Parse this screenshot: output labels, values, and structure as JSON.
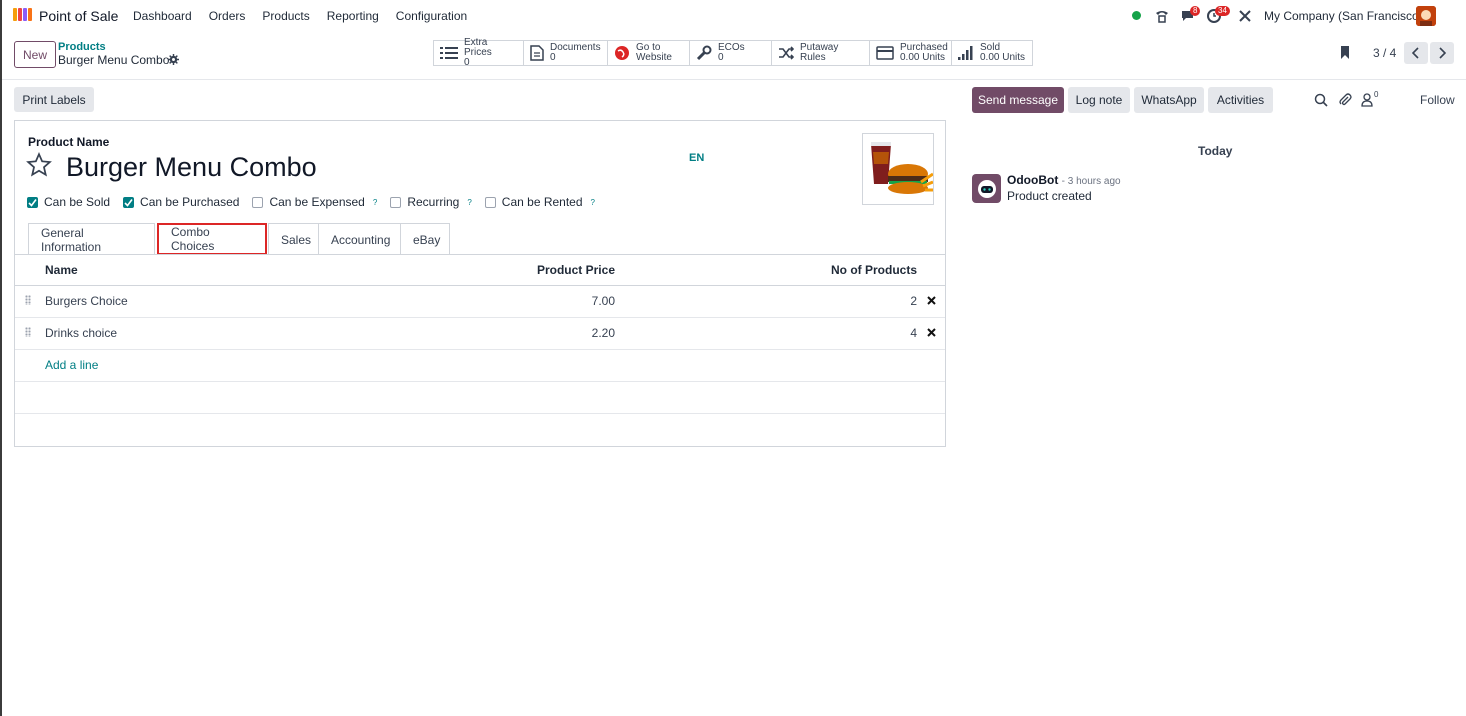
{
  "app": {
    "name": "Point of Sale",
    "menu": [
      "Dashboard",
      "Orders",
      "Products",
      "Reporting",
      "Configuration"
    ]
  },
  "systray": {
    "messages_count": "8",
    "activities_count": "34",
    "company": "My Company (San Francisco)"
  },
  "control": {
    "new_label": "New",
    "breadcrumb_parent": "Products",
    "breadcrumb_current": "Burger Menu Combo",
    "stats": [
      {
        "icon": "list-icon",
        "label": "Extra Prices",
        "value": "0"
      },
      {
        "icon": "document-icon",
        "label": "Documents",
        "value": "0"
      },
      {
        "icon": "globe-icon",
        "label": "Go to",
        "value": "Website"
      },
      {
        "icon": "wrench-icon",
        "label": "ECOs",
        "value": "0"
      },
      {
        "icon": "shuffle-icon",
        "label": "Putaway Rules",
        "value": ""
      },
      {
        "icon": "credit-card-icon",
        "label": "Purchased",
        "value": "0.00 Units"
      },
      {
        "icon": "signal-icon",
        "label": "Sold",
        "value": "0.00 Units"
      }
    ],
    "pager": "3 / 4"
  },
  "form": {
    "print_labels": "Print Labels",
    "product_name_label": "Product Name",
    "product_name": "Burger Menu Combo",
    "lang": "EN",
    "checks": [
      {
        "label": "Can be Sold",
        "checked": true,
        "help": ""
      },
      {
        "label": "Can be Purchased",
        "checked": true,
        "help": ""
      },
      {
        "label": "Can be Expensed",
        "checked": false,
        "help": "?"
      },
      {
        "label": "Recurring",
        "checked": false,
        "help": "?"
      },
      {
        "label": "Can be Rented",
        "checked": false,
        "help": "?"
      }
    ],
    "tabs": [
      "General Information",
      "Combo Choices",
      "Sales",
      "Accounting",
      "eBay"
    ],
    "active_tab": "Combo Choices",
    "table": {
      "headers": [
        "Name",
        "Product Price",
        "No of Products"
      ],
      "rows": [
        {
          "name": "Burgers Choice",
          "price": "7.00",
          "qty": "2"
        },
        {
          "name": "Drinks choice",
          "price": "2.20",
          "qty": "4"
        }
      ],
      "add_line": "Add a line"
    }
  },
  "chatter": {
    "send_message": "Send message",
    "log_note": "Log note",
    "whatsapp": "WhatsApp",
    "activities": "Activities",
    "followers_count": "0",
    "follow": "Follow",
    "today": "Today",
    "message": {
      "author": "OdooBot",
      "time": "- 3 hours ago",
      "body": "Product created"
    }
  },
  "colors": {
    "brand": "#714b67",
    "accent": "#017e84",
    "highlight": "#dc2626"
  }
}
